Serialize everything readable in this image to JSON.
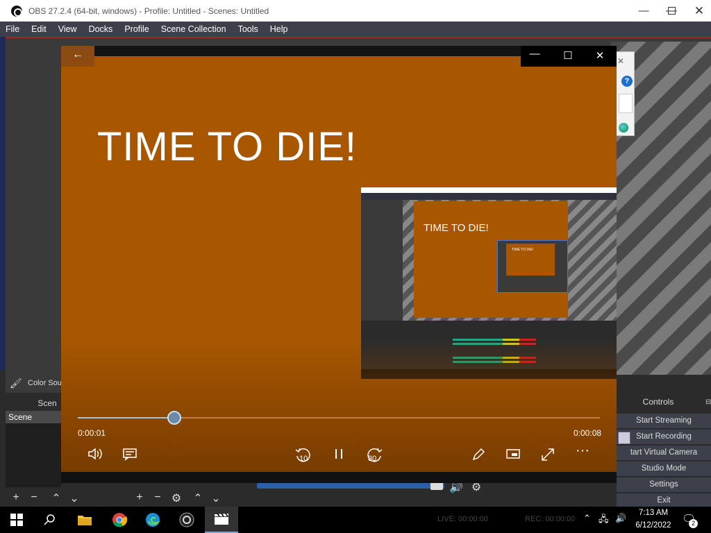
{
  "obs": {
    "window_title": "OBS 27.2.4 (64-bit, windows) - Profile: Untitled - Scenes: Untitled",
    "menu": [
      "File",
      "Edit",
      "View",
      "Docks",
      "Profile",
      "Scene Collection",
      "Tools",
      "Help"
    ],
    "source_label": "Color Sou",
    "scenes_header": "Scen",
    "scene_item": "Scene",
    "controls_title": "Controls",
    "controls": [
      "Start Streaming",
      "Start Recording",
      "tart Virtual Camera",
      "Studio Mode",
      "Settings",
      "Exit"
    ],
    "status": {
      "live": "LIVE: 00:00:00",
      "rec": "REC: 00:00:00"
    }
  },
  "player": {
    "headline": "TIME TO DIE!",
    "current_time": "0:00:01",
    "total_time": "0:00:08",
    "progress_fraction": 0.185,
    "skip_back_label": "10",
    "skip_forward_label": "30",
    "thumb_headline": "TIME TO DIE!",
    "thumb_inner_headline": "TIME TO DIE!"
  },
  "taskbar": {
    "time": "7:13 AM",
    "date": "6/12/2022",
    "notifications": "2"
  },
  "colors": {
    "video_bg": "#a85700",
    "obs_menubar": "#3c404b",
    "seek_fill": "#9cc8e8"
  }
}
